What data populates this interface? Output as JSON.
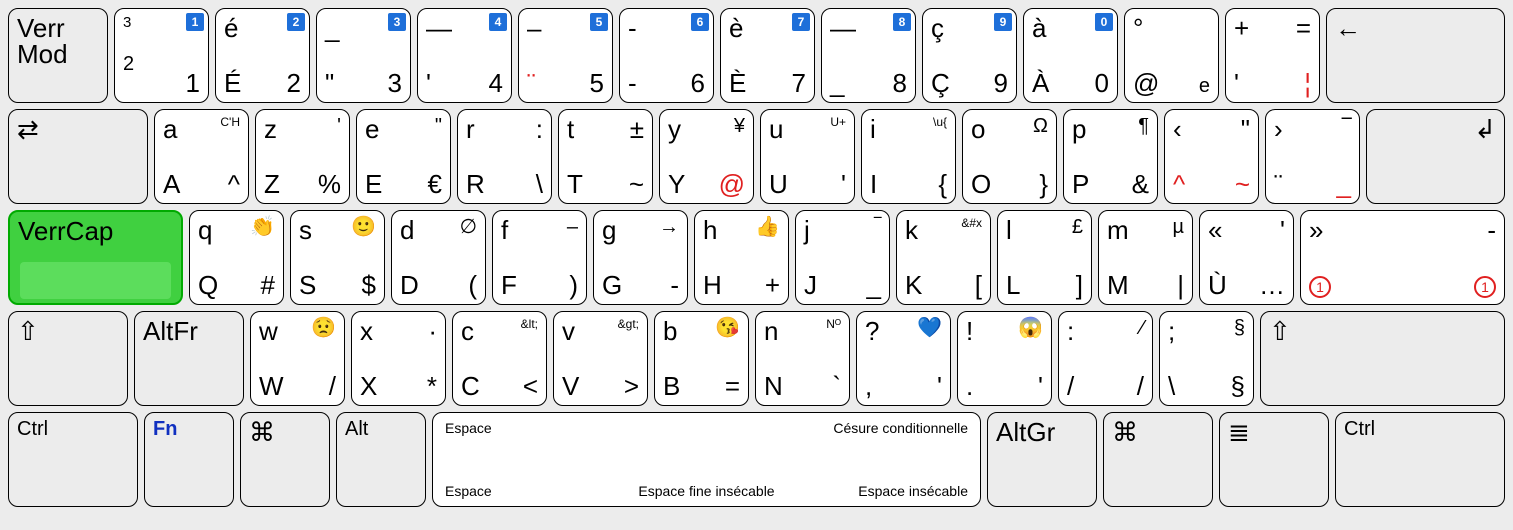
{
  "row1": {
    "k0": {
      "tl1": "Verr",
      "tl2": "Mod"
    },
    "k1": {
      "tl": "3",
      "bl": "2",
      "br": "1",
      "badge": "1"
    },
    "k2": {
      "tl": "é",
      "bl": "É",
      "br": "2",
      "badge": "2"
    },
    "k3": {
      "tl": "_",
      "bl": "\"",
      "br": "3",
      "badge": "3"
    },
    "k4": {
      "tl": "—",
      "bl": "'",
      "br": "4",
      "badge": "4"
    },
    "k5": {
      "tl": "–",
      "bl": "¨",
      "br": "5",
      "badge": "5"
    },
    "k6": {
      "tl": "-",
      "bl": "-",
      "br": "6",
      "badge": "6"
    },
    "k7": {
      "tl": "è",
      "bl": "È",
      "br": "7",
      "badge": "7"
    },
    "k8": {
      "tl": "—",
      "bl": "_",
      "br": "8",
      "badge": "8"
    },
    "k9": {
      "tl": "ç",
      "bl": "Ç",
      "br": "9",
      "badge": "9"
    },
    "k10": {
      "tl": "à",
      "bl": "À",
      "br": "0",
      "badge": "0"
    },
    "k11": {
      "tl": "°",
      "bl": "@",
      "br": "e"
    },
    "k12": {
      "tl": "+",
      "tr": "=",
      "bl": "'",
      "br": "¦"
    },
    "k13": {
      "tl": "←"
    }
  },
  "row2": {
    "k0": {
      "tl": "⇄"
    },
    "k1": {
      "tl": "a",
      "tr": "C'H",
      "bl": "A",
      "br": "^"
    },
    "k2": {
      "tl": "z",
      "tr": "'",
      "bl": "Z",
      "br": "%"
    },
    "k3": {
      "tl": "e",
      "tr": "\"",
      "bl": "E",
      "br": "€"
    },
    "k4": {
      "tl": "r",
      "tr": ":",
      "bl": "R",
      "br": "\\"
    },
    "k5": {
      "tl": "t",
      "tr": "±",
      "bl": "T",
      "br": "~"
    },
    "k6": {
      "tl": "y",
      "tr": "¥",
      "bl": "Y",
      "br": "@"
    },
    "k7": {
      "tl": "u",
      "tr": "U+",
      "bl": "U",
      "br": "'"
    },
    "k8": {
      "tl": "i",
      "tr": "\\u{",
      "bl": "I",
      "br": "{"
    },
    "k9": {
      "tl": "o",
      "tr": "Ω",
      "bl": "O",
      "br": "}"
    },
    "k10": {
      "tl": "p",
      "tr": "¶",
      "bl": "P",
      "br": "&"
    },
    "k11": {
      "tl": "‹",
      "tr": "\"",
      "bl": "^",
      "br": "~"
    },
    "k12": {
      "tl": "›",
      "tr": "‾",
      "bl": "¨",
      "br": "_"
    },
    "k13": {
      "tr": "↲"
    }
  },
  "row3": {
    "k0": {
      "tl": "VerrCap"
    },
    "k1": {
      "tl": "q",
      "tr": "👏",
      "bl": "Q",
      "br": "#"
    },
    "k2": {
      "tl": "s",
      "tr": "🙂",
      "bl": "S",
      "br": "$"
    },
    "k3": {
      "tl": "d",
      "tr": "∅",
      "bl": "D",
      "br": "("
    },
    "k4": {
      "tl": "f",
      "tr": "–",
      "bl": "F",
      "br": ")"
    },
    "k5": {
      "tl": "g",
      "tr": "→",
      "bl": "G",
      "br": "-"
    },
    "k6": {
      "tl": "h",
      "tr": "👍",
      "bl": "H",
      "br": "+"
    },
    "k7": {
      "tl": "j",
      "tr": "‾",
      "bl": "J",
      "br": "_"
    },
    "k8": {
      "tl": "k",
      "tr": "&#x",
      "bl": "K",
      "br": "["
    },
    "k9": {
      "tl": "l",
      "tr": "£",
      "bl": "L",
      "br": "]"
    },
    "k10": {
      "tl": "m",
      "tr": "µ",
      "bl": "M",
      "br": "|"
    },
    "k11": {
      "tl": "«",
      "tr": "'",
      "bl": "Ù",
      "br": "…"
    },
    "k12": {
      "tl": "»",
      "tr": "-",
      "bl": "①",
      "br": "①"
    }
  },
  "row4": {
    "k0": {
      "tl": "⇧"
    },
    "k1": {
      "tl": "AltFr"
    },
    "k2": {
      "tl": "w",
      "tr": "😟",
      "bl": "W",
      "br": "/"
    },
    "k3": {
      "tl": "x",
      "tr": "·",
      "bl": "X",
      "br": "*"
    },
    "k4": {
      "tl": "c",
      "tr": "&lt;",
      "bl": "C",
      "br": "<"
    },
    "k5": {
      "tl": "v",
      "tr": "&gt;",
      "bl": "V",
      "br": ">"
    },
    "k6": {
      "tl": "b",
      "tr": "😘",
      "bl": "B",
      "br": "="
    },
    "k7": {
      "tl": "n",
      "tr": "Nᴼ",
      "bl": "N",
      "br": "`"
    },
    "k8": {
      "tl": "?",
      "tr": "💙",
      "bl": ",",
      "br": "'"
    },
    "k9": {
      "tl": "!",
      "tr": "😱",
      "bl": ".",
      "br": "'"
    },
    "k10": {
      "tl": ":",
      "tr": "⁄",
      "bl": "/",
      "br": "/"
    },
    "k11": {
      "tl": ";",
      "tr": "§",
      "bl": "\\",
      "br": "§"
    },
    "k12": {
      "tl": "⇧"
    }
  },
  "row5": {
    "k0": {
      "tl": "Ctrl"
    },
    "k1": {
      "tl": "Fn"
    },
    "k2": {
      "tl": "⌘"
    },
    "k3": {
      "tl": "Alt"
    },
    "k4": {
      "stl": "Espace",
      "str": "Césure conditionnelle",
      "sbl": "Espace",
      "sbc": "Espace fine insécable",
      "sbr": "Espace insécable"
    },
    "k5": {
      "tl": "AltGr"
    },
    "k6": {
      "tl": "⌘"
    },
    "k7": {
      "tl": "≣"
    },
    "k8": {
      "tl": "Ctrl"
    }
  }
}
